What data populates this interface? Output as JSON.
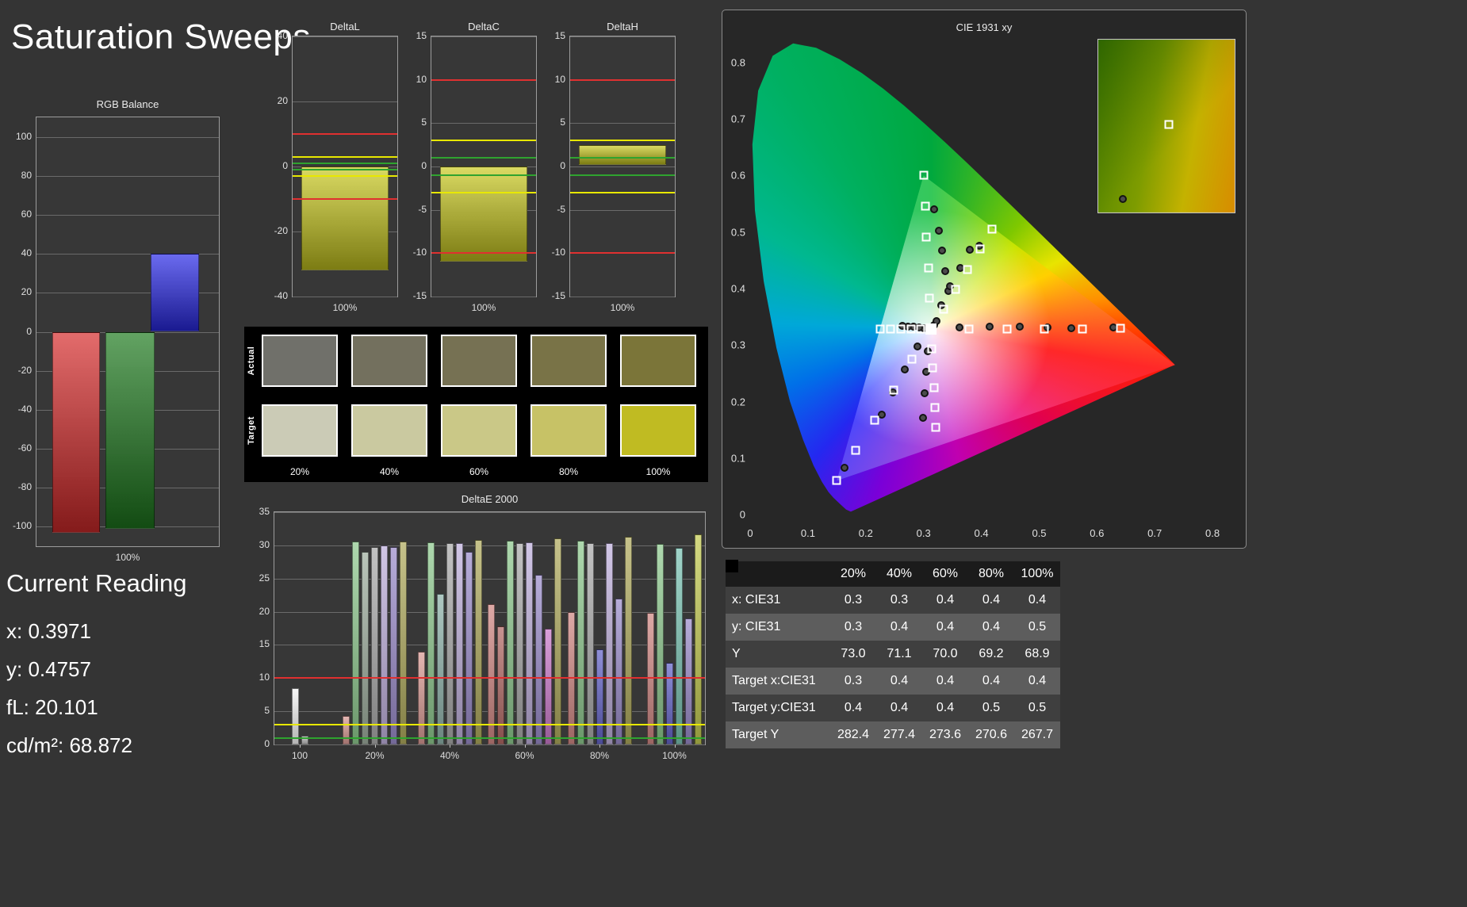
{
  "page": {
    "title": "Saturation Sweeps"
  },
  "current_reading": {
    "heading": "Current Reading",
    "x": "x: 0.3971",
    "y": "y: 0.4757",
    "fl": "fL: 20.101",
    "cdm2": "cd/m²: 68.872"
  },
  "swatch_panel": {
    "row_labels": [
      "Actual",
      "Target"
    ],
    "col_labels": [
      "20%",
      "40%",
      "60%",
      "80%",
      "100%"
    ],
    "actual_colors": [
      "#70706a",
      "#73705e",
      "#767153",
      "#797347",
      "#7b7539"
    ],
    "target_colors": [
      "#cbcbb6",
      "#cac9a0",
      "#cac887",
      "#c7c266",
      "#c0bb22"
    ]
  },
  "table": {
    "columns": [
      "",
      "20%",
      "40%",
      "60%",
      "80%",
      "100%"
    ],
    "rows": [
      {
        "label": "x: CIE31",
        "values": [
          "0.3",
          "0.3",
          "0.4",
          "0.4",
          "0.4"
        ]
      },
      {
        "label": "y: CIE31",
        "values": [
          "0.3",
          "0.4",
          "0.4",
          "0.4",
          "0.5"
        ]
      },
      {
        "label": "Y",
        "values": [
          "73.0",
          "71.1",
          "70.0",
          "69.2",
          "68.9"
        ]
      },
      {
        "label": "Target x:CIE31",
        "values": [
          "0.3",
          "0.4",
          "0.4",
          "0.4",
          "0.4"
        ]
      },
      {
        "label": "Target y:CIE31",
        "values": [
          "0.4",
          "0.4",
          "0.4",
          "0.5",
          "0.5"
        ]
      },
      {
        "label": "Target Y",
        "values": [
          "282.4",
          "277.4",
          "273.6",
          "270.6",
          "267.7"
        ]
      }
    ]
  },
  "chart_data": [
    {
      "id": "rgb-balance",
      "type": "bar",
      "title": "RGB Balance",
      "xlabel": "100%",
      "ylim": [
        -110,
        110
      ],
      "yticks": [
        -100,
        -80,
        -60,
        -40,
        -20,
        0,
        20,
        40,
        60,
        80,
        100
      ],
      "series": [
        {
          "name": "red",
          "from": 0,
          "to": -103,
          "color": "#d62b2b"
        },
        {
          "name": "green",
          "from": 0,
          "to": -101,
          "color": "#1e7a1e"
        },
        {
          "name": "blue",
          "from": 0,
          "to": 40,
          "color": "#2a2ae8"
        }
      ]
    },
    {
      "id": "delta-l",
      "type": "bar",
      "title": "DeltaL",
      "xlabel": "100%",
      "ylim": [
        -40,
        40
      ],
      "yticks": [
        -40,
        -20,
        0,
        20,
        40
      ],
      "ref_lines": [
        {
          "y": 10,
          "color": "#e03030"
        },
        {
          "y": 3,
          "color": "#e8e800"
        },
        {
          "y": 1,
          "color": "#2fa32f"
        },
        {
          "y": -1,
          "color": "#2fa32f"
        },
        {
          "y": -3,
          "color": "#e8e800"
        },
        {
          "y": -10,
          "color": "#e03030"
        }
      ],
      "series": [
        {
          "name": "deltaL",
          "from": 0,
          "to": -32,
          "color": "#c9c91f"
        }
      ]
    },
    {
      "id": "delta-c",
      "type": "bar",
      "title": "DeltaC",
      "xlabel": "100%",
      "ylim": [
        -15,
        15
      ],
      "yticks": [
        -15,
        -10,
        -5,
        0,
        5,
        10,
        15
      ],
      "ref_lines": [
        {
          "y": 10,
          "color": "#e03030"
        },
        {
          "y": 3,
          "color": "#e8e800"
        },
        {
          "y": 1,
          "color": "#2fa32f"
        },
        {
          "y": -1,
          "color": "#2fa32f"
        },
        {
          "y": -3,
          "color": "#e8e800"
        },
        {
          "y": -10,
          "color": "#e03030"
        }
      ],
      "series": [
        {
          "name": "deltaC",
          "from": 0,
          "to": -11,
          "color": "#c9c91f"
        }
      ]
    },
    {
      "id": "delta-h",
      "type": "bar",
      "title": "DeltaH",
      "xlabel": "100%",
      "ylim": [
        -15,
        15
      ],
      "yticks": [
        -15,
        -10,
        -5,
        0,
        5,
        10,
        15
      ],
      "ref_lines": [
        {
          "y": 10,
          "color": "#e03030"
        },
        {
          "y": 3,
          "color": "#e8e800"
        },
        {
          "y": 1,
          "color": "#2fa32f"
        },
        {
          "y": -1,
          "color": "#2fa32f"
        },
        {
          "y": -3,
          "color": "#e8e800"
        },
        {
          "y": -10,
          "color": "#e03030"
        }
      ],
      "series": [
        {
          "name": "deltaH",
          "from": 0.2,
          "to": 2.5,
          "color": "#c9c91f"
        }
      ]
    },
    {
      "id": "delta-e",
      "type": "grouped-bar",
      "title": "DeltaE 2000",
      "ylim": [
        0,
        35
      ],
      "yticks": [
        0,
        5,
        10,
        15,
        20,
        25,
        30,
        35
      ],
      "ref_lines": [
        {
          "y": 10,
          "color": "#e03030"
        },
        {
          "y": 3,
          "color": "#e8e800"
        },
        {
          "y": 1,
          "color": "#2fa32f"
        }
      ],
      "groups": [
        {
          "label": "100",
          "bars": [
            {
              "v": 8.5,
              "c": "#f2f2f2"
            },
            {
              "v": 1.3,
              "c": "#bdbdbd"
            }
          ]
        },
        {
          "label": "20%",
          "bars": [
            {
              "v": 4.3,
              "c": "#d89a94"
            },
            {
              "v": 30.6,
              "c": "#8fc98f"
            },
            {
              "v": 29.0,
              "c": "#9fae9f"
            },
            {
              "v": 29.8,
              "c": "#ababab"
            },
            {
              "v": 30.0,
              "c": "#bfb0dc"
            },
            {
              "v": 29.8,
              "c": "#9b8ccb"
            },
            {
              "v": 30.6,
              "c": "#b0ab5e"
            }
          ]
        },
        {
          "label": "40%",
          "bars": [
            {
              "v": 14.0,
              "c": "#d89a94"
            },
            {
              "v": 30.5,
              "c": "#8fc98f"
            },
            {
              "v": 22.7,
              "c": "#8fb3ab"
            },
            {
              "v": 30.3,
              "c": "#ababab"
            },
            {
              "v": 30.4,
              "c": "#bfb0dc"
            },
            {
              "v": 29.0,
              "c": "#9b8ccb"
            },
            {
              "v": 30.8,
              "c": "#b0ab5e"
            }
          ]
        },
        {
          "label": "60%",
          "bars": [
            {
              "v": 21.2,
              "c": "#d08884"
            },
            {
              "v": 17.8,
              "c": "#b26a66"
            },
            {
              "v": 30.7,
              "c": "#8fc98f"
            },
            {
              "v": 30.4,
              "c": "#ababab"
            },
            {
              "v": 30.5,
              "c": "#bfb0dc"
            },
            {
              "v": 25.6,
              "c": "#9b8ccb"
            },
            {
              "v": 17.5,
              "c": "#cb7acb"
            },
            {
              "v": 31.1,
              "c": "#b0ab5e"
            }
          ]
        },
        {
          "label": "80%",
          "bars": [
            {
              "v": 20.0,
              "c": "#d08884"
            },
            {
              "v": 30.7,
              "c": "#8fc98f"
            },
            {
              "v": 30.3,
              "c": "#ababab"
            },
            {
              "v": 14.3,
              "c": "#6464c8"
            },
            {
              "v": 30.3,
              "c": "#bfb0dc"
            },
            {
              "v": 22.0,
              "c": "#9b8ccb"
            },
            {
              "v": 31.3,
              "c": "#b0ab5e"
            }
          ]
        },
        {
          "label": "100%",
          "bars": [
            {
              "v": 19.8,
              "c": "#d08884"
            },
            {
              "v": 30.2,
              "c": "#8fc98f"
            },
            {
              "v": 12.3,
              "c": "#6464c8"
            },
            {
              "v": 29.6,
              "c": "#7cc4b4"
            },
            {
              "v": 19.0,
              "c": "#9b8ccb"
            },
            {
              "v": 31.7,
              "c": "#c3ca52"
            }
          ]
        }
      ]
    },
    {
      "id": "cie",
      "type": "scatter",
      "title": "CIE 1931 xy",
      "xlim": [
        0,
        0.83
      ],
      "ylim": [
        0,
        0.842
      ],
      "xticks": [
        0,
        0.1,
        0.2,
        0.3,
        0.4,
        0.5,
        0.6,
        0.7,
        0.8
      ],
      "yticks": [
        0,
        0.1,
        0.2,
        0.3,
        0.4,
        0.5,
        0.6,
        0.7,
        0.8
      ],
      "white_point": [
        0.3127,
        0.329
      ],
      "gamut_triangle": [
        [
          0.735,
          0.265
        ],
        [
          0.3,
          0.6
        ],
        [
          0.15,
          0.06
        ]
      ],
      "targets": [
        [
          0.378,
          0.329
        ],
        [
          0.444,
          0.329
        ],
        [
          0.509,
          0.329
        ],
        [
          0.575,
          0.329
        ],
        [
          0.64,
          0.33
        ],
        [
          0.31,
          0.383
        ],
        [
          0.308,
          0.437
        ],
        [
          0.305,
          0.491
        ],
        [
          0.303,
          0.546
        ],
        [
          0.3,
          0.6
        ],
        [
          0.28,
          0.275
        ],
        [
          0.248,
          0.221
        ],
        [
          0.215,
          0.167
        ],
        [
          0.183,
          0.114
        ],
        [
          0.15,
          0.06
        ],
        [
          0.295,
          0.329
        ],
        [
          0.278,
          0.329
        ],
        [
          0.26,
          0.329
        ],
        [
          0.243,
          0.329
        ],
        [
          0.225,
          0.329
        ],
        [
          0.314,
          0.294
        ],
        [
          0.316,
          0.259
        ],
        [
          0.318,
          0.224
        ],
        [
          0.319,
          0.189
        ],
        [
          0.321,
          0.154
        ],
        [
          0.334,
          0.364
        ],
        [
          0.355,
          0.399
        ],
        [
          0.376,
          0.434
        ],
        [
          0.398,
          0.47
        ],
        [
          0.419,
          0.505
        ]
      ],
      "measurements": [
        [
          0.362,
          0.331
        ],
        [
          0.414,
          0.332
        ],
        [
          0.466,
          0.332
        ],
        [
          0.515,
          0.331
        ],
        [
          0.556,
          0.33
        ],
        [
          0.628,
          0.331
        ],
        [
          0.318,
          0.54
        ],
        [
          0.326,
          0.502
        ],
        [
          0.332,
          0.468
        ],
        [
          0.338,
          0.431
        ],
        [
          0.343,
          0.396
        ],
        [
          0.289,
          0.297
        ],
        [
          0.268,
          0.257
        ],
        [
          0.247,
          0.216
        ],
        [
          0.227,
          0.177
        ],
        [
          0.163,
          0.083
        ],
        [
          0.301,
          0.33
        ],
        [
          0.292,
          0.331
        ],
        [
          0.283,
          0.332
        ],
        [
          0.273,
          0.333
        ],
        [
          0.264,
          0.334
        ],
        [
          0.307,
          0.289
        ],
        [
          0.305,
          0.252
        ],
        [
          0.302,
          0.215
        ],
        [
          0.299,
          0.171
        ],
        [
          0.33,
          0.371
        ],
        [
          0.346,
          0.404
        ],
        [
          0.363,
          0.437
        ],
        [
          0.38,
          0.469
        ],
        [
          0.397,
          0.476
        ],
        [
          0.318,
          0.336
        ],
        [
          0.323,
          0.342
        ]
      ],
      "inset": {
        "square": [
          0.52,
          0.49
        ],
        "circle": [
          0.18,
          0.92
        ]
      }
    }
  ]
}
